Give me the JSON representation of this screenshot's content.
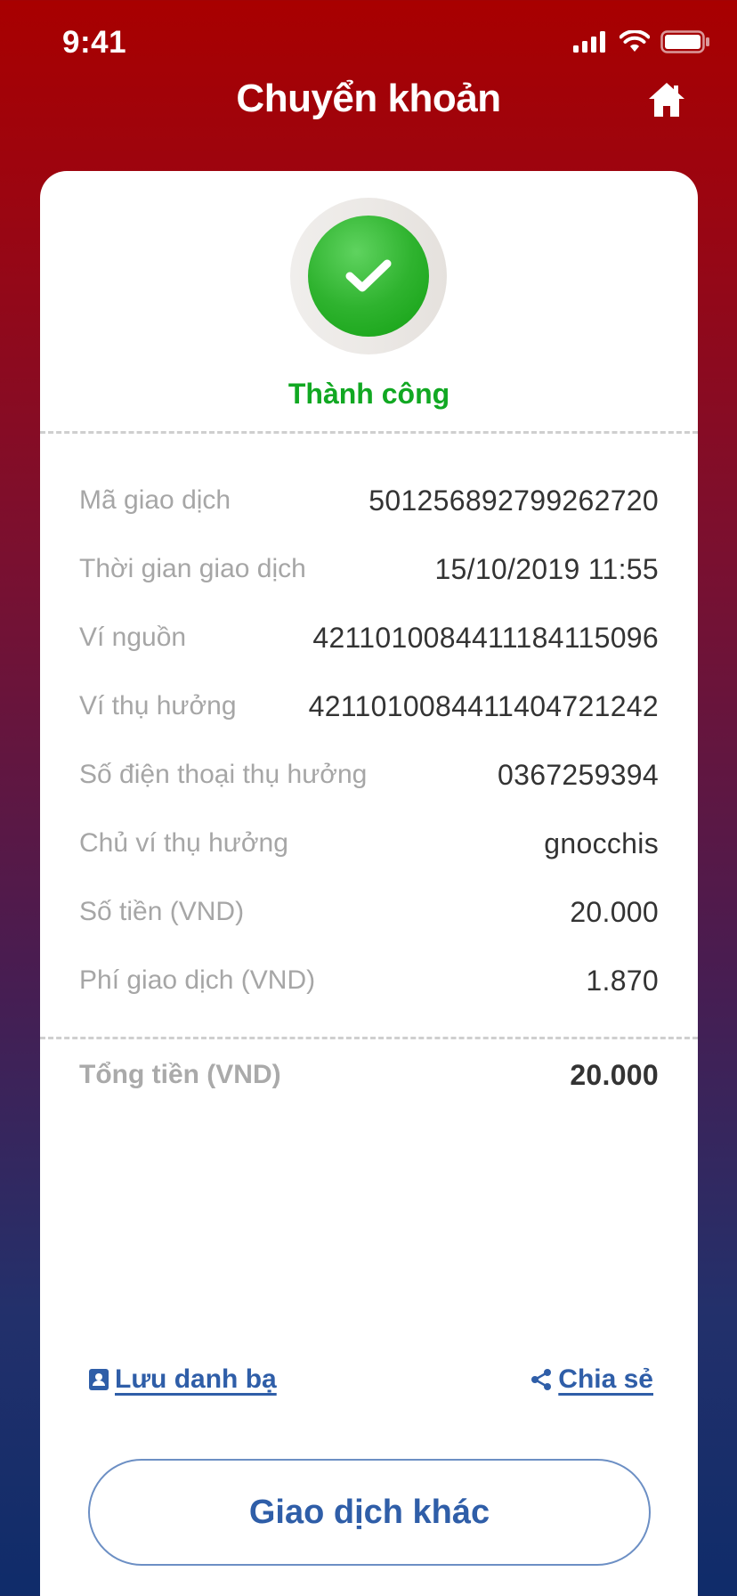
{
  "status_bar": {
    "time": "9:41"
  },
  "header": {
    "title": "Chuyển khoản"
  },
  "result": {
    "status": "Thành công"
  },
  "details": [
    {
      "label": "Mã giao dịch",
      "value": "501256892799262720"
    },
    {
      "label": "Thời gian giao dịch",
      "value": "15/10/2019 11:55"
    },
    {
      "label": "Ví nguồn",
      "value": "4211010084411184115096"
    },
    {
      "label": "Ví thụ hưởng",
      "value": "4211010084411404721242"
    },
    {
      "label": "Số điện thoại thụ hưởng",
      "value": "0367259394"
    },
    {
      "label": "Chủ ví thụ hưởng",
      "value": "gnocchis"
    },
    {
      "label": "Số tiền (VND)",
      "value": "20.000"
    },
    {
      "label": "Phí giao dịch (VND)",
      "value": "1.870"
    }
  ],
  "total": {
    "label": "Tổng tiền (VND)",
    "value": "20.000"
  },
  "actions": {
    "save_contact": "Lưu danh bạ",
    "share": "Chia sẻ",
    "other_transaction": "Giao dịch khác"
  },
  "colors": {
    "success": "#11a822",
    "link": "#2f5ea8",
    "header_red": "#a80000"
  },
  "icons": {
    "signal": "cellular-signal-icon",
    "wifi": "wifi-icon",
    "battery": "battery-icon",
    "home": "home-icon",
    "check": "checkmark-icon",
    "contact": "contact-book-icon",
    "share": "share-icon"
  }
}
